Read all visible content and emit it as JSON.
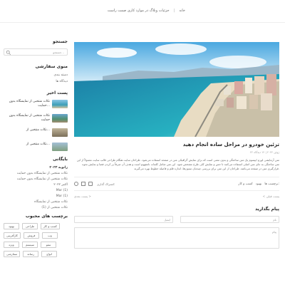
{
  "breadcrumb": {
    "home": "خانه",
    "current": "جزئیات وبلاگ در موارد کاری صمت راست"
  },
  "sidebar": {
    "search": {
      "title": "جستجو",
      "placeholder": "جستجو..."
    },
    "menu": {
      "title": "منوی سفارشی",
      "items": [
        "دسته بندی",
        "دیدگاه ها"
      ]
    },
    "posts": {
      "title": "پست اخیر",
      "items": [
        {
          "label": "نکات منتخبی از نمایشگاه بدون حمایت..."
        },
        {
          "label": "نکات منتخبی از نمایشگاه بدون حمایت"
        },
        {
          "label": "نکات منتخبی از..."
        },
        {
          "label": "نکات منتخبی از..."
        }
      ]
    },
    "archive": {
      "title": "بایگانی",
      "subtitle": "ژانویه ۲۰۲۳",
      "items": [
        "نکات منتخبی از نمایشگاه بدون حمایت",
        "نکات منتخبی از نمایشگاه بدون حمایت",
        "اکتبر ۲۰۲۲",
        "Mar (1)",
        "Mar (1)",
        "نکات منتخبی از نمایشگاه",
        "نکات منتخبی از (1)"
      ]
    },
    "tags": {
      "title": "برچسب های محبوب",
      "items": [
        "بهبود",
        "طراحی",
        "کسب و کار",
        "کارآفرینی",
        "فروش",
        "وب",
        "ویژه",
        "سیستم",
        "سئو",
        "سفارشی",
        "رسانه",
        "انواع"
      ]
    }
  },
  "article": {
    "title": "تزئین خودرو در مراحل ساده انجام دهید",
    "meta": "۲۲ ژوئن ۲۰۲۲ | ۱۲ دیدگاه",
    "paragraph": "متن آزمایشی لورم ایپسوم یک متن ساختگی و بدون معنی است که برای نمایش گرافیکی متن در صفحه استفاده می‌شود. طراحان سایت هنگام طراحی قالب سایت معمولاً از این متن ساختگی به جای متن اصلی استفاده می‌کنند تا حس و نمایش کلی طرح مشخص شود. این متن شامل کلمات نامفهوم است و هدف آن صرفاً پر کردن فضا و نمایش نحوه قرارگیری متن در صفحه می‌باشد. طراحان از این متن برای بررسی چیدمان ستون‌ها، اندازه قلم و فاصله خطوط بهره می‌گیرند.",
    "tags_label": "برچسب ها:",
    "tag_links": [
      "بهبود",
      "کسب و کار"
    ],
    "share_label": "اشتراک گذاری:",
    "prev": "< پست قبلی",
    "next": "پست بعدی >"
  },
  "comment": {
    "title": "پیام بگذارید",
    "name_placeholder": "نام",
    "email_placeholder": "ایمیل",
    "message_placeholder": "پیام"
  },
  "colors": {
    "accent": "#1a73e8",
    "sea": "#2fb5c7",
    "sky": "#7cc5ea"
  }
}
